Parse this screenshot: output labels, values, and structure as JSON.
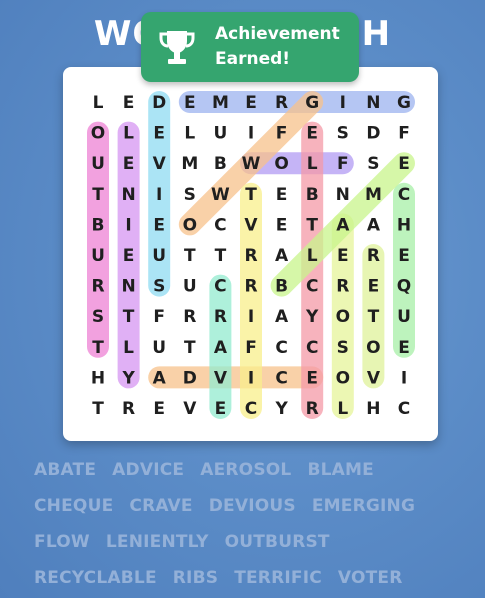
{
  "title": "WORD SEARCH",
  "toast": {
    "line1": "Achievement",
    "line2": "Earned!",
    "icon": "trophy-icon"
  },
  "grid": [
    "LEDEMERGING",
    "OLELUIFESDF",
    "UEVMBWOLFSE",
    "TNISWTEBNMC",
    "BIEOCVETAAHH",
    "UEUTTRALERE",
    "RNSUCRBCREQ",
    "STFRRIAYOTU",
    "TLUTAFCCSOE",
    "HYADVICEOVI",
    "TREVECYRLHC"
  ],
  "highlights": [
    {
      "word": "EMERGING",
      "color": "#9db3f0",
      "from": [
        0,
        3
      ],
      "to": [
        0,
        10
      ]
    },
    {
      "word": "OUTBURST",
      "color": "#ee82d5",
      "from": [
        1,
        0
      ],
      "to": [
        8,
        0
      ]
    },
    {
      "word": "LENIENTLY",
      "color": "#d696f2",
      "from": [
        1,
        1
      ],
      "to": [
        9,
        1
      ]
    },
    {
      "word": "DEVIOUS",
      "color": "#8fdcf2",
      "from": [
        0,
        2
      ],
      "to": [
        6,
        2
      ]
    },
    {
      "word": "FLOW",
      "color": "#b29bf4",
      "from": [
        2,
        8
      ],
      "to": [
        2,
        5
      ]
    },
    {
      "word": "ADVICE",
      "color": "#f8c28c",
      "from": [
        9,
        2
      ],
      "to": [
        9,
        7
      ]
    },
    {
      "word": "ABATE",
      "color": "#f8c28c",
      "from": [
        0,
        7
      ],
      "to": [
        4,
        3
      ]
    },
    {
      "word": "RECYCLABLE",
      "color": "#f59aa8",
      "from": [
        1,
        7
      ],
      "to": [
        10,
        7
      ]
    },
    {
      "word": "TERRIFIC",
      "color": "#f9ef8c",
      "from": [
        3,
        5
      ],
      "to": [
        10,
        5
      ]
    },
    {
      "word": "CRAVE",
      "color": "#93ecd0",
      "from": [
        6,
        4
      ],
      "to": [
        10,
        4
      ]
    },
    {
      "word": "AEROSOL",
      "color": "#e6f59a",
      "from": [
        4,
        8
      ],
      "to": [
        10,
        8
      ]
    },
    {
      "word": "VOTER",
      "color": "#dff29a",
      "from": [
        9,
        9
      ],
      "to": [
        5,
        9
      ]
    },
    {
      "word": "CHEQUE",
      "color": "#a8f0a8",
      "from": [
        3,
        10
      ],
      "to": [
        8,
        10
      ]
    },
    {
      "word": "BLAME",
      "color": "#c9f58c",
      "from": [
        6,
        6
      ],
      "to": [
        2,
        10
      ]
    }
  ],
  "words": [
    "ABATE",
    "ADVICE",
    "AEROSOL",
    "BLAME",
    "CHEQUE",
    "CRAVE",
    "DEVIOUS",
    "EMERGING",
    "FLOW",
    "LENIENTLY",
    "OUTBURST",
    "RECYCLABLE",
    "RIBS",
    "TERRIFIC",
    "VOTER"
  ]
}
